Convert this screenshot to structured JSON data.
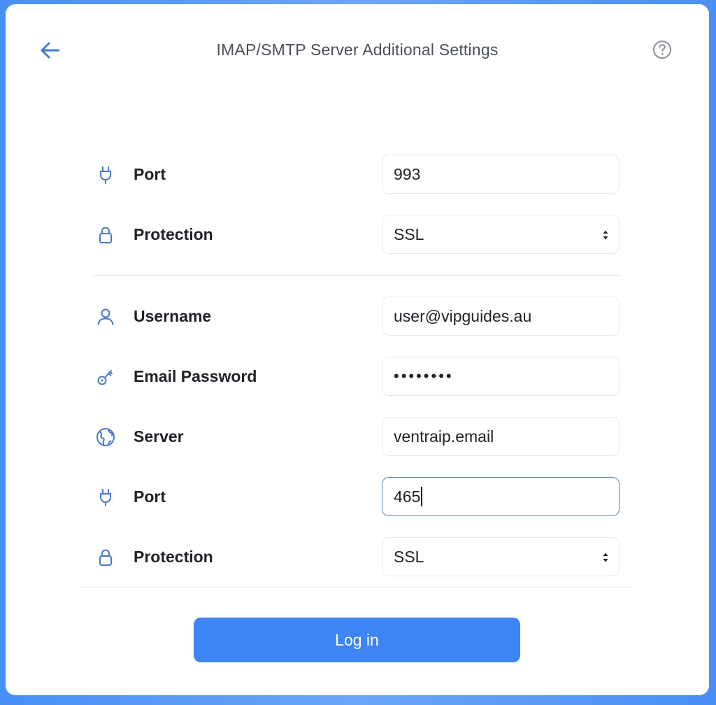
{
  "header": {
    "title": "IMAP/SMTP Server Additional Settings",
    "back_icon": "arrow-left-icon",
    "help_icon": "help-circle-icon"
  },
  "imap": {
    "port": {
      "label": "Port",
      "value": "993",
      "icon": "plug-icon"
    },
    "protection": {
      "label": "Protection",
      "value": "SSL",
      "icon": "lock-icon"
    }
  },
  "smtp": {
    "username": {
      "label": "Username",
      "value": "user@vipguides.au",
      "icon": "user-icon"
    },
    "password": {
      "label": "Email Password",
      "value": "••••••••",
      "icon": "key-icon"
    },
    "server": {
      "label": "Server",
      "value": "ventraip.email",
      "icon": "globe-icon"
    },
    "port": {
      "label": "Port",
      "value": "465",
      "icon": "plug-icon"
    },
    "protection": {
      "label": "Protection",
      "value": "SSL",
      "icon": "lock-icon"
    }
  },
  "actions": {
    "login_label": "Log in"
  },
  "colors": {
    "accent": "#3d84f4",
    "icon": "#4a78c8",
    "background": "#5a9bf7"
  }
}
